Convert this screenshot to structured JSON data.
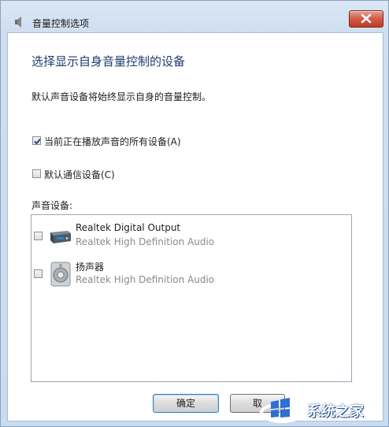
{
  "window": {
    "title": "音量控制选项"
  },
  "heading": "选择显示自身音量控制的设备",
  "description": "默认声音设备将始终显示自身的音量控制。",
  "options": [
    {
      "label": "当前正在播放声音的所有设备(A)",
      "checked": true
    },
    {
      "label": "默认通信设备(C)",
      "checked": false
    }
  ],
  "devices_label": "声音设备:",
  "devices": [
    {
      "name": "Realtek Digital Output",
      "subtitle": "Realtek High Definition Audio",
      "icon": "digital-output-icon",
      "checked": false
    },
    {
      "name": "扬声器",
      "subtitle": "Realtek High Definition Audio",
      "icon": "speaker-icon",
      "checked": false
    }
  ],
  "buttons": {
    "ok": "确定",
    "cancel": "取"
  },
  "watermark": {
    "text": "系统之家"
  }
}
